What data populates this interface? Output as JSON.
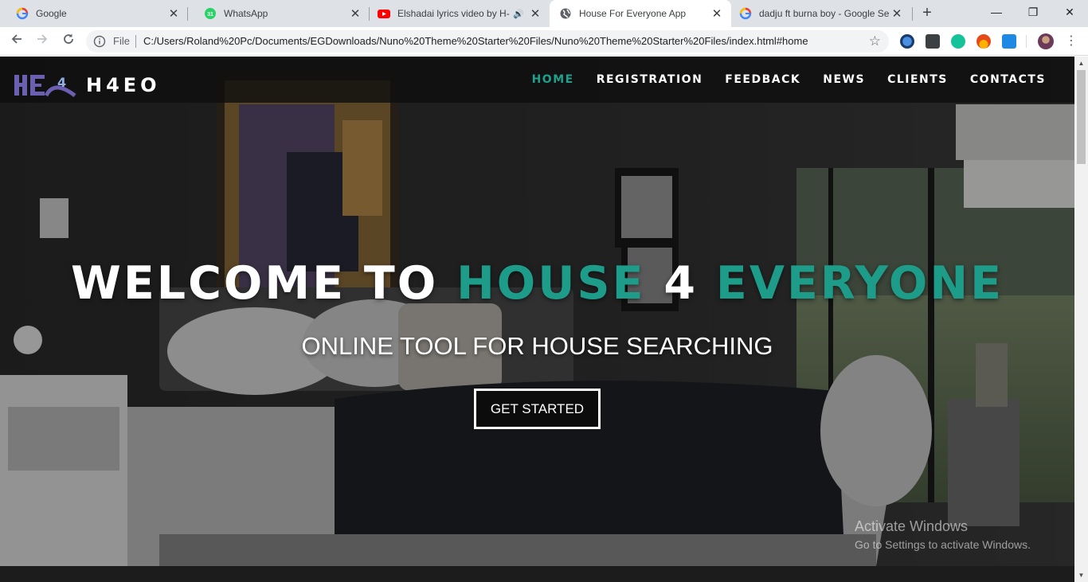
{
  "browser": {
    "tabs": [
      {
        "title": "Google",
        "icon": "google-icon",
        "active": false
      },
      {
        "title": "WhatsApp",
        "icon": "whatsapp-icon",
        "badge": "31",
        "active": false
      },
      {
        "title": "Elshadai lyrics video by H-c",
        "icon": "youtube-icon",
        "active": false
      },
      {
        "title": "House For Everyone App",
        "icon": "globe-icon",
        "active": true
      },
      {
        "title": "dadju ft burna boy - Google Se",
        "icon": "google-icon",
        "active": false
      }
    ],
    "address": {
      "scheme_label": "File",
      "url": "C:/Users/Roland%20Pc/Documents/EGDownloads/Nuno%20Theme%20Starter%20Files/Nuno%20Theme%20Starter%20Files/index.html#home"
    }
  },
  "site": {
    "logo_text": "H4EO",
    "logo_mark_text": "4",
    "nav": [
      "HOME",
      "REGISTRATION",
      "FEEDBACK",
      "NEWS",
      "CLIENTS",
      "CONTACTS"
    ],
    "hero": {
      "welcome": "WELCOME TO",
      "house": "HOUSE",
      "four": "4",
      "everyone": "EVERYONE",
      "subtitle": "ONLINE TOOL FOR HOUSE SEARCHING",
      "cta_label": "GET STARTED"
    }
  },
  "watermark": {
    "title": "Activate Windows",
    "subtitle": "Go to Settings to activate Windows."
  },
  "colors": {
    "accent": "#1d9d89",
    "nav_active": "#1fa08c"
  }
}
